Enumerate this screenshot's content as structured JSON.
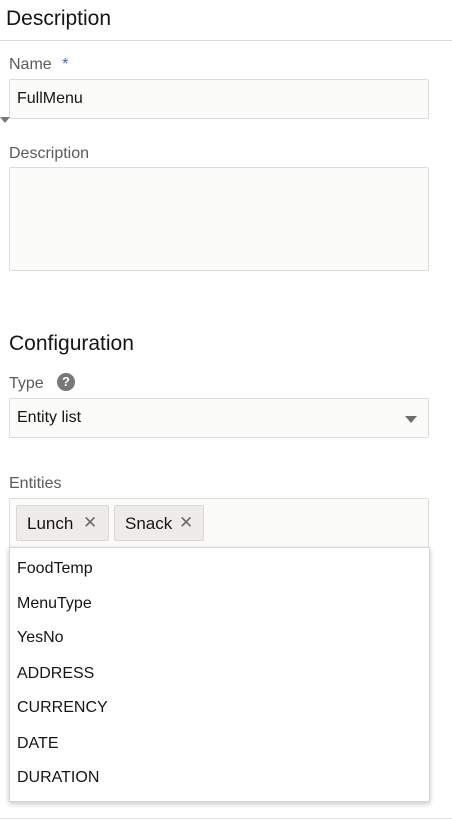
{
  "description_section": {
    "title": "Description",
    "name_label": "Name",
    "required_marker": "*",
    "name_value": "FullMenu",
    "description_label": "Description",
    "description_value": ""
  },
  "configuration_section": {
    "title": "Configuration",
    "type_label": "Type",
    "type_help_icon": "help-circle-icon",
    "type_value": "Entity list",
    "entities_label": "Entities",
    "selected_entities": [
      {
        "label": "Lunch",
        "remove_glyph": "✕"
      },
      {
        "label": "Snack",
        "remove_glyph": "✕"
      }
    ],
    "entity_options": [
      "FoodTemp",
      "MenuType",
      "YesNo",
      "ADDRESS",
      "CURRENCY",
      "DATE",
      "DURATION"
    ]
  },
  "colors": {
    "required": "#2b6fd6",
    "help_icon": "#7a7874",
    "field_bg": "#fbfbfa",
    "chip_bg": "#eeecea"
  }
}
